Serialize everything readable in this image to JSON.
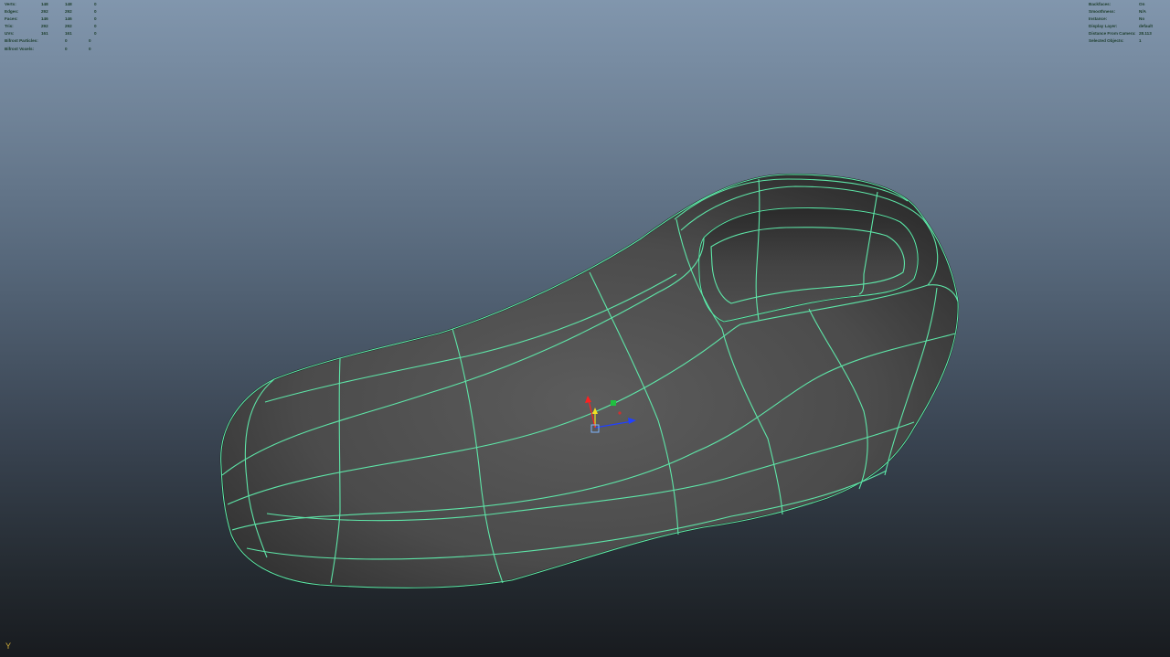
{
  "heads_up_left": [
    {
      "label": "Verts:",
      "v1": "148",
      "v2": "148",
      "v3": "0"
    },
    {
      "label": "Edges:",
      "v1": "292",
      "v2": "292",
      "v3": "0"
    },
    {
      "label": "Faces:",
      "v1": "146",
      "v2": "146",
      "v3": "0"
    },
    {
      "label": "Tris:",
      "v1": "292",
      "v2": "292",
      "v3": "0"
    },
    {
      "label": "UVs:",
      "v1": "161",
      "v2": "161",
      "v3": "0"
    },
    {
      "label": "Bifrost Particles:",
      "v1": "0",
      "v2": "0",
      "v3": ""
    },
    {
      "label": "Bifrost Voxels:",
      "v1": "0",
      "v2": "0",
      "v3": ""
    }
  ],
  "heads_up_right": [
    {
      "label": "Backfaces:",
      "value": "On"
    },
    {
      "label": "Smoothness:",
      "value": "N/A"
    },
    {
      "label": "Instance:",
      "value": "No"
    },
    {
      "label": "Display Layer:",
      "value": "default"
    },
    {
      "label": "Distance From Camera:",
      "value": "28.113"
    },
    {
      "label": "Selected Objects:",
      "value": "1"
    }
  ],
  "viewport": {
    "wireframe_color": "#5ee6a8",
    "mesh_color": "#4a4a4a"
  },
  "manipulator": {
    "x_color": "#2040ff",
    "y_color": "#f0e020",
    "z_color": "#ff2020"
  },
  "axis_indicator": "Y"
}
